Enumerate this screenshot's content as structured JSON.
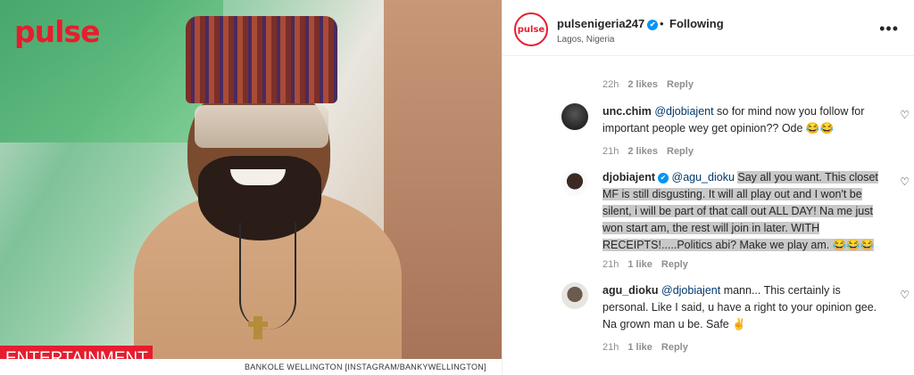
{
  "photo": {
    "brand": "pulse",
    "category_label": "ENTERTAINMENT",
    "caption": "BANKOLE WELLINGTON [INSTAGRAM/BANKYWELLINGTON]"
  },
  "header": {
    "username": "pulsenigeria247",
    "verified_mark": "✔",
    "separator": "•",
    "follow_state": "Following",
    "location": "Lagos, Nigeria",
    "more_label": "•••",
    "avatar_text": "pulse"
  },
  "top_meta": {
    "time": "22h",
    "likes": "2 likes",
    "reply": "Reply"
  },
  "comments": [
    {
      "username": "unc.chim",
      "mention": "@djobiajent",
      "text": " so for mind now you follow for important people wey get opinion?? Ode 😂😂",
      "time": "21h",
      "likes": "2 likes",
      "reply": "Reply"
    },
    {
      "username": "djobiajent",
      "verified_mark": "✔",
      "mention": "@agu_dioku",
      "text_plain": " ",
      "text_highlight": "Say all you want. This closet MF is still disgusting. It will all play out and I won't be silent, i will be part of that call out ALL DAY! Na me just won start am, the rest will join in later. WITH RECEIPTS!.....Politics abi? Make we play am. 😂😂😂",
      "time": "21h",
      "likes": "1 like",
      "reply": "Reply"
    },
    {
      "username": "agu_dioku",
      "mention": "@djobiajent",
      "text": " mann... This certainly is personal. Like I said, u have a right to your opinion gee. Na grown man u be. Safe ✌",
      "time": "21h",
      "likes": "1 like",
      "reply": "Reply"
    }
  ],
  "icons": {
    "heart": "heart-icon",
    "more": "more-options-icon",
    "verified": "verified-badge-icon"
  },
  "colors": {
    "brand_red": "#e61d2e",
    "verified_blue": "#0095f6",
    "mention_blue": "#00376b"
  }
}
